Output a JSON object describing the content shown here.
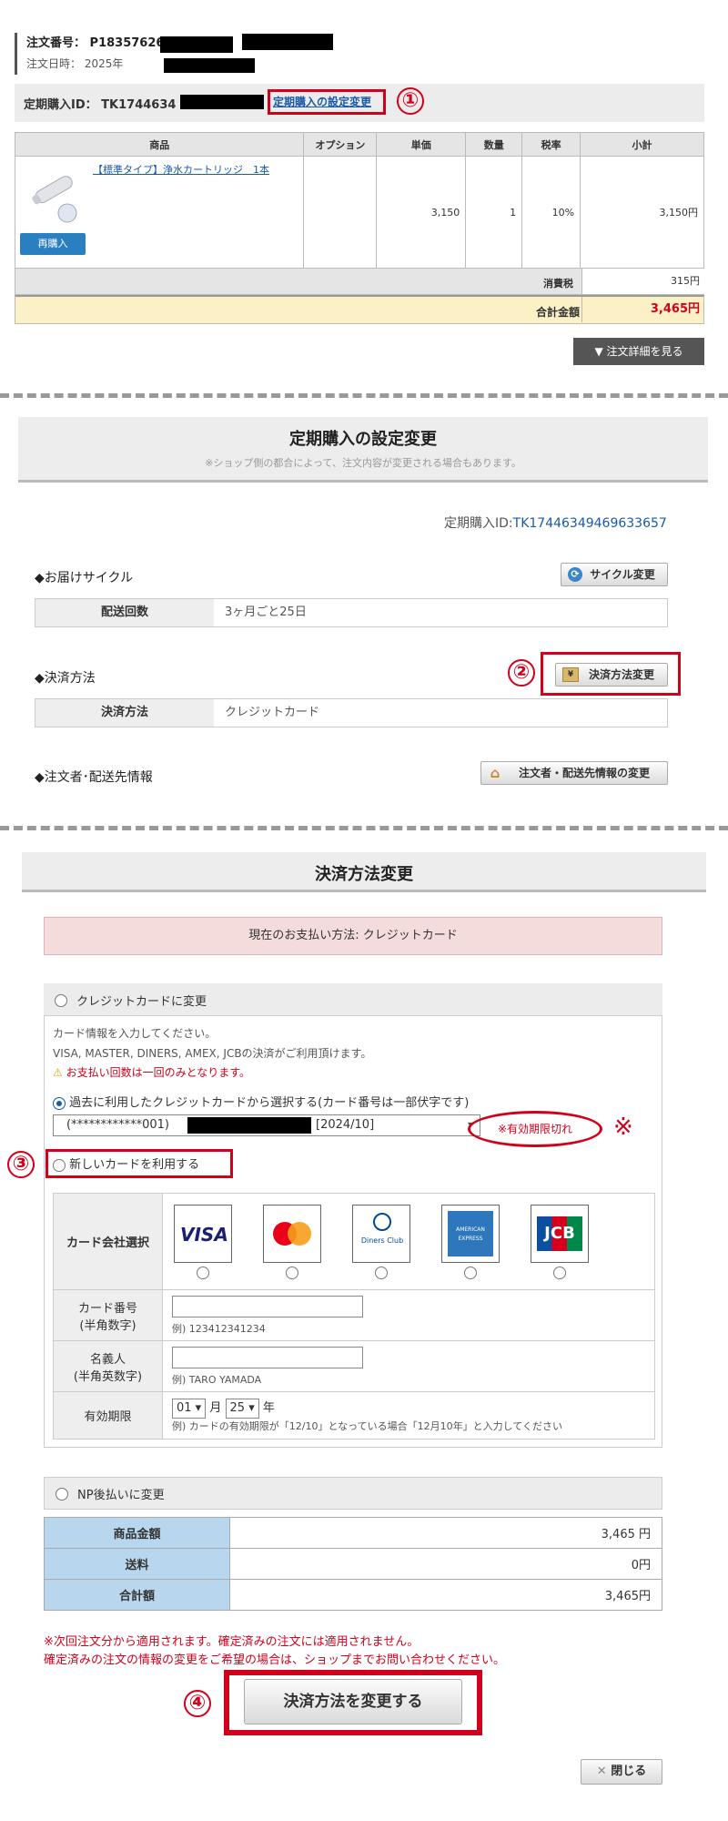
{
  "order": {
    "number_label": "注文番号：",
    "number": "P18357626",
    "date_label": "注文日時：",
    "date": "2025年",
    "teiki_id_label": "定期購入ID：",
    "teiki_id": "TK1744634",
    "teiki_change_link": "定期購入の設定変更"
  },
  "markers": [
    "①",
    "②",
    "③",
    "④",
    "※"
  ],
  "items_table": {
    "headers": [
      "商品",
      "オプション",
      "単価",
      "数量",
      "税率",
      "小計"
    ],
    "product_name": "【標準タイプ】浄水カートリッジ　1本",
    "rebuy": "再購入",
    "unit_price": "3,150",
    "quantity": "1",
    "tax_rate": "10%",
    "subtotal": "3,150円",
    "tax_label": "消費税",
    "tax_value": "315円",
    "total_label": "合計金額",
    "total_value": "3,465円",
    "detail_button": "▼ 注文詳細を見る"
  },
  "teiki_settings": {
    "title": "定期購入の設定変更",
    "subtitle": "※ショップ側の都合によって、注文内容が変更される場合もあります。",
    "id_label": "定期購入ID:",
    "id_value": "TK17446349469633657",
    "cycle_label": "◆お届けサイクル",
    "cycle_button": "サイクル変更",
    "delivery_key": "配送回数",
    "delivery_value": "3ヶ月ごと25日",
    "payment_label": "◆決済方法",
    "payment_button": "決済方法変更",
    "payment_key": "決済方法",
    "payment_value": "クレジットカード",
    "customer_label": "◆注文者･配送先情報",
    "customer_button": "注文者・配送先情報の変更"
  },
  "payment_change": {
    "title": "決済方法変更",
    "current": "現在のお支払い方法: クレジットカード",
    "credit_option": "クレジットカードに変更",
    "info1": "カード情報を入力してください。",
    "info2": "VISA, MASTER, DINERS, AMEX, JCBの決済がご利用頂けます。",
    "info3": "お支払い回数は一回のみとなります。",
    "past_card_option": "過去に利用したクレジットカードから選択する(カード番号は一部伏字です)",
    "past_card_number": "(************001)",
    "past_card_expiry": "[2024/10]",
    "expired_note": "※有効期限切れ",
    "new_card_option": "新しいカードを利用する",
    "card_company_label": "カード会社選択",
    "card_brands": [
      "VISA",
      "Mastercard",
      "Diners Club",
      "AMERICAN EXPRESS",
      "JCB"
    ],
    "card_number_label": "カード番号\n(半角数字)",
    "card_number_example": "例) 123412341234",
    "holder_label": "名義人\n(半角英数字)",
    "holder_example": "例) TARO YAMADA",
    "expiry_label": "有効期限",
    "expiry_month": "01",
    "expiry_month_unit": "月",
    "expiry_year": "25",
    "expiry_year_unit": "年",
    "expiry_example": "例) カードの有効期限が「12/10」となっている場合「12月10年」と入力してください",
    "np_option": "NP後払いに変更",
    "summary": [
      {
        "label": "商品金額",
        "value": "3,465 円"
      },
      {
        "label": "送料",
        "value": "0円"
      },
      {
        "label": "合計額",
        "value": "3,465円"
      }
    ],
    "note1": "※次回注文分から適用されます。確定済みの注文には適用されません。",
    "note2": "確定済みの注文の情報の変更をご希望の場合は、ショップまでお問い合わせください。",
    "submit": "決済方法を変更する",
    "close": "閉じる"
  },
  "colors": {
    "annotation_red": "#d0021b",
    "link_blue": "#1a5aa8",
    "rebuy_blue": "#2a7fc1",
    "total_yellow": "#fbf0c6",
    "summary_blue": "#b8d7ef"
  }
}
